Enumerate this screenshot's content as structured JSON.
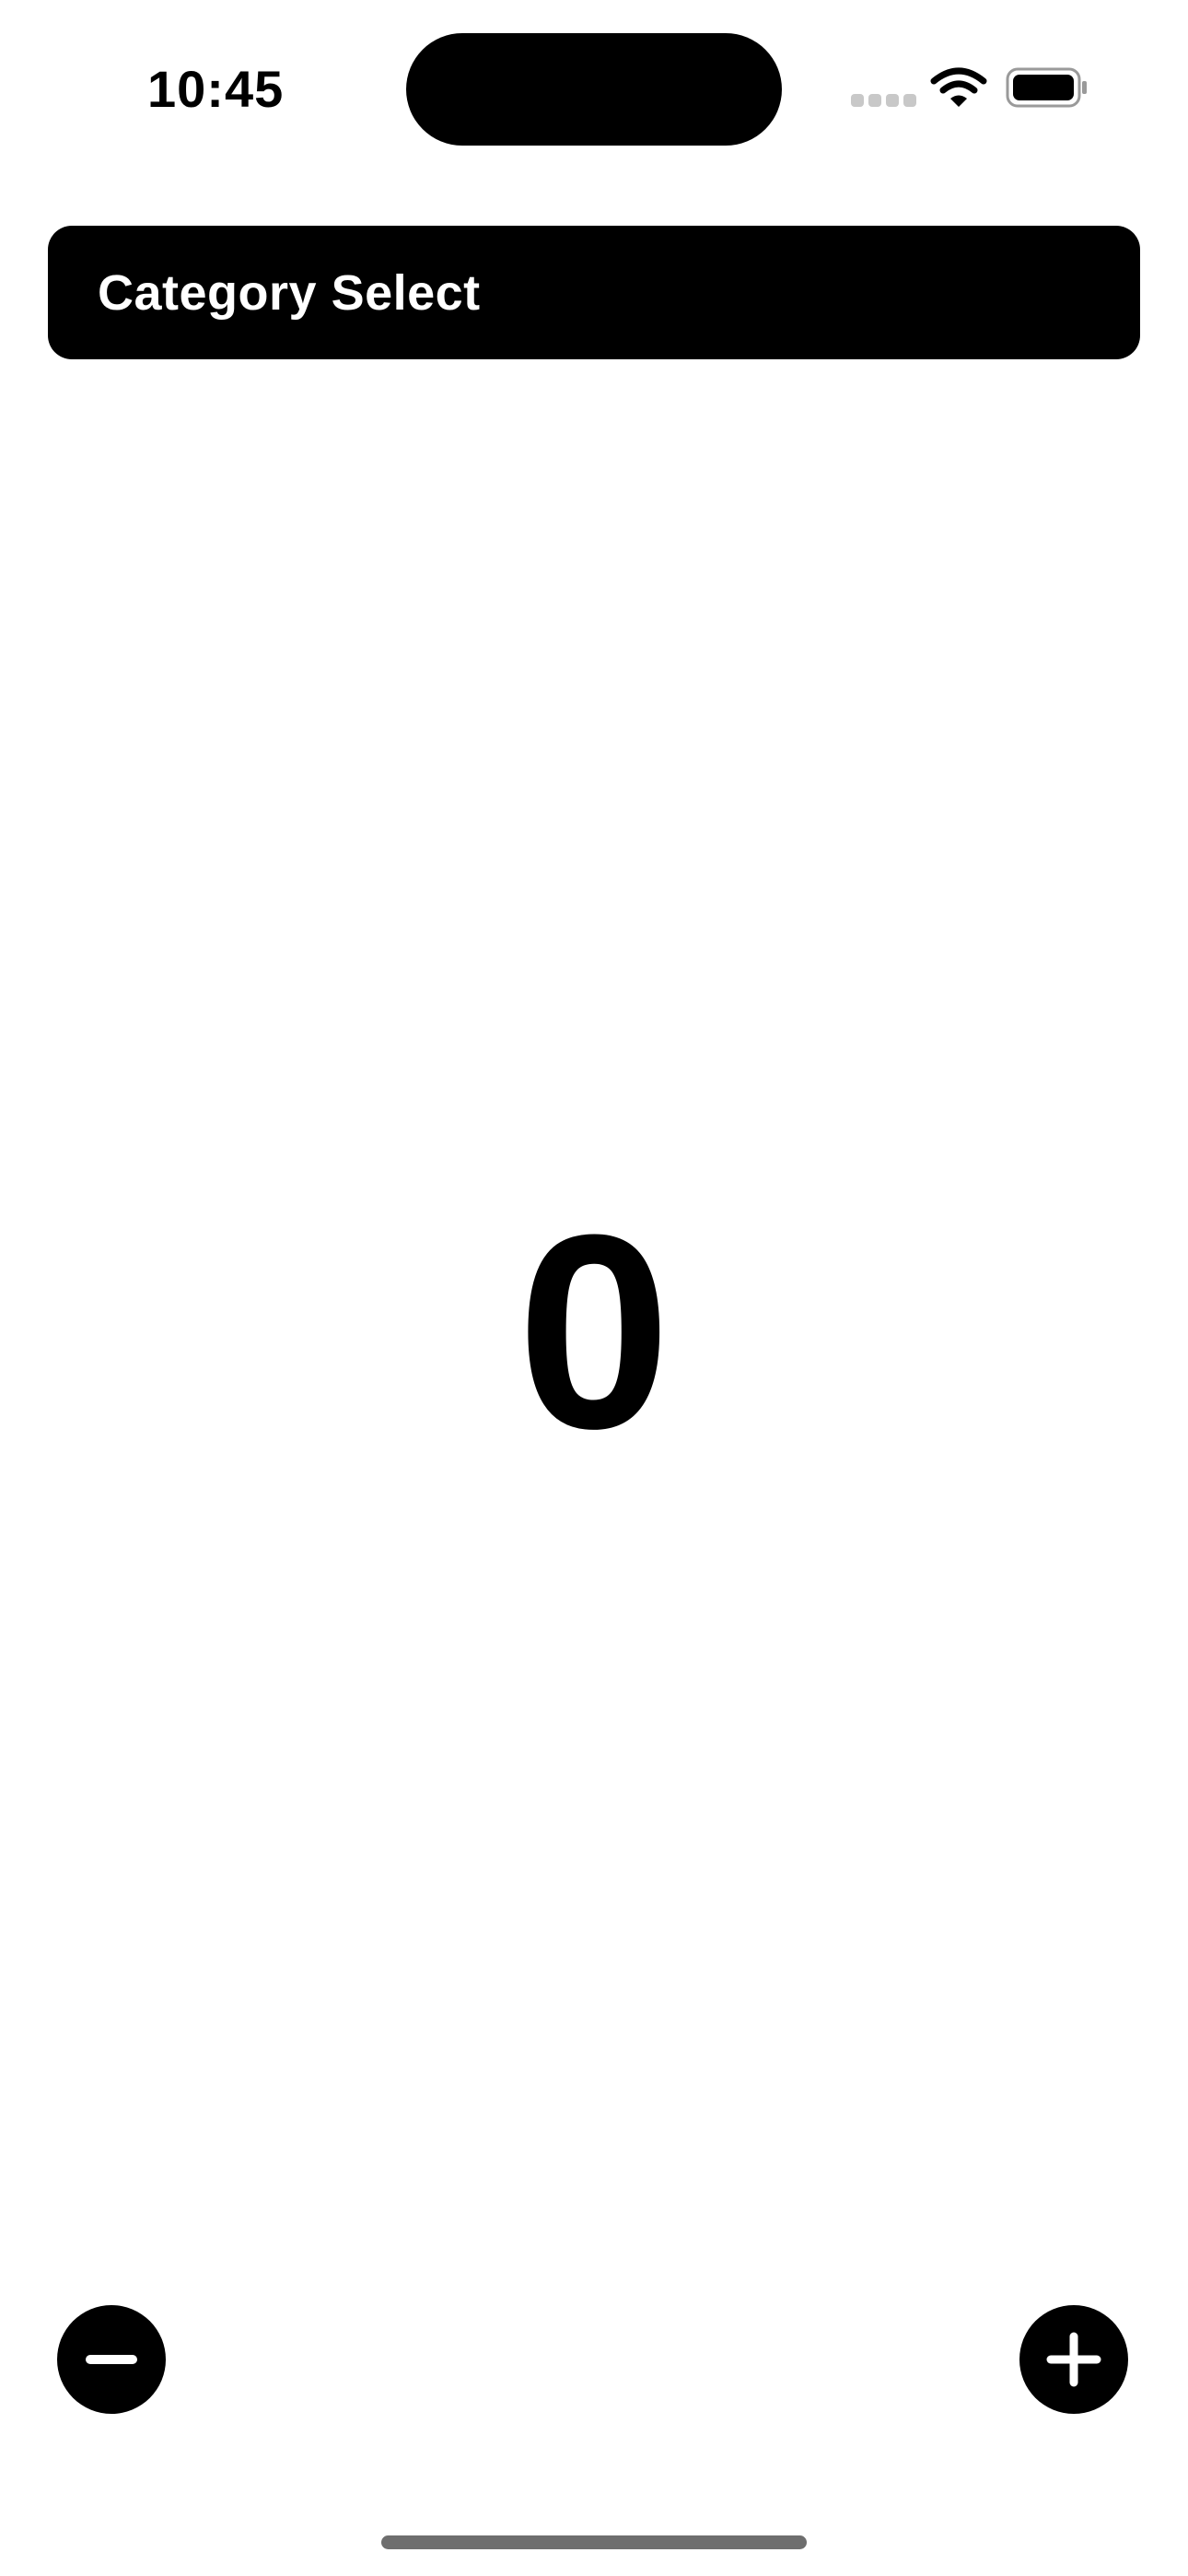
{
  "status_bar": {
    "time": "10:45",
    "signal_icon": "cellular-signal-icon",
    "wifi_icon": "wifi-icon",
    "battery_icon": "battery-icon"
  },
  "header": {
    "title": "Category Select"
  },
  "counter": {
    "value": "0"
  },
  "controls": {
    "decrement_icon": "minus-icon",
    "increment_icon": "plus-icon"
  },
  "colors": {
    "background": "#ffffff",
    "foreground": "#000000",
    "accent_text": "#ffffff"
  }
}
